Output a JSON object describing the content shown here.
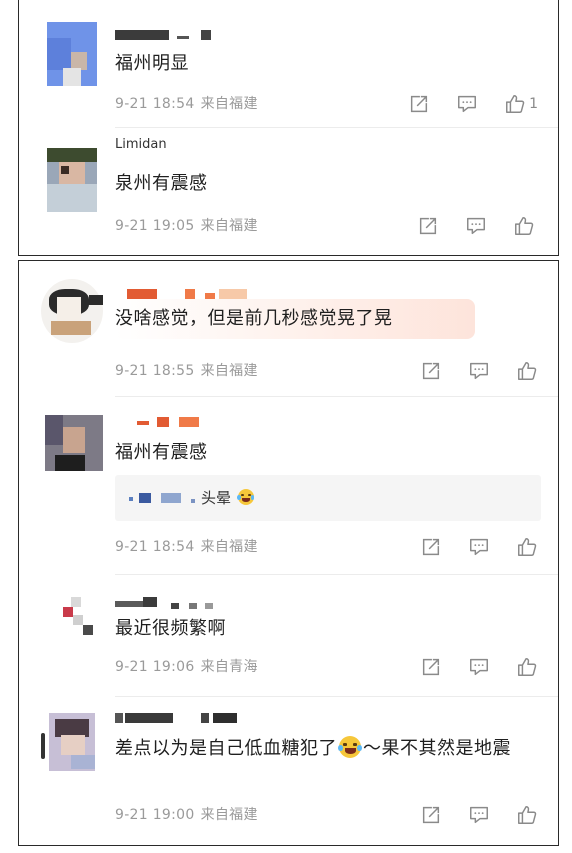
{
  "colors": {
    "text": "#1f1f1f",
    "meta": "#9a9a9a",
    "icon": "#8a8a8a",
    "reply_bg": "#f5f5f5",
    "border": "#2a2a2a"
  },
  "panel1": {
    "comments": [
      {
        "name": "",
        "text": "福州明显",
        "time": "9-21 18:54",
        "location": "来自福建",
        "like_count": "1"
      },
      {
        "name": "Limidan",
        "text": "泉州有震感",
        "time": "9-21 19:05",
        "location": "来自福建",
        "like_count": ""
      }
    ]
  },
  "panel2": {
    "comments": [
      {
        "name": "",
        "text": "没啥感觉，但是前几秒感觉晃了晃",
        "time": "9-21 18:55",
        "location": "来自福建",
        "like_count": ""
      },
      {
        "name": "",
        "text": "福州有震感",
        "time": "9-21 18:54",
        "location": "来自福建",
        "like_count": "",
        "reply": {
          "text": "头晕"
        }
      },
      {
        "name": "",
        "text": "最近很频繁啊",
        "time": "9-21 19:06",
        "location": "来自青海",
        "like_count": ""
      },
      {
        "name": "",
        "text_before_emoji": "差点以为是自己低血糖犯了",
        "text_after_emoji": "～果不其然是地震",
        "time": "9-21 19:00",
        "location": "来自福建",
        "like_count": ""
      }
    ]
  },
  "icons": {
    "share": "share-icon",
    "comment": "comment-icon",
    "like": "like-icon",
    "emoji_laugh": "laughing-tears-emoji",
    "emoji_grin": "grinning-emoji"
  }
}
